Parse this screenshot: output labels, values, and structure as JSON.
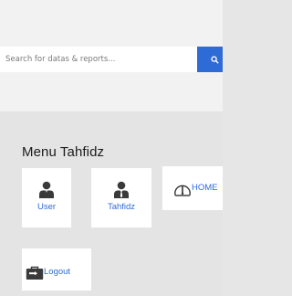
{
  "search": {
    "placeholder": "Search for datas & reports..."
  },
  "menu": {
    "title": "Menu Tahfidz",
    "items": [
      {
        "label": "User",
        "icon": "user-icon"
      },
      {
        "label": "Tahfidz",
        "icon": "teacher-icon"
      },
      {
        "label": "HOME",
        "icon": "dashboard-icon"
      },
      {
        "label": "Logout",
        "icon": "briefcase-icon"
      }
    ]
  },
  "colors": {
    "accent": "#2f6bd6",
    "background": "#e4e4e4",
    "header_bg": "#f2f2f2",
    "icon_dark": "#3a3a3a"
  }
}
